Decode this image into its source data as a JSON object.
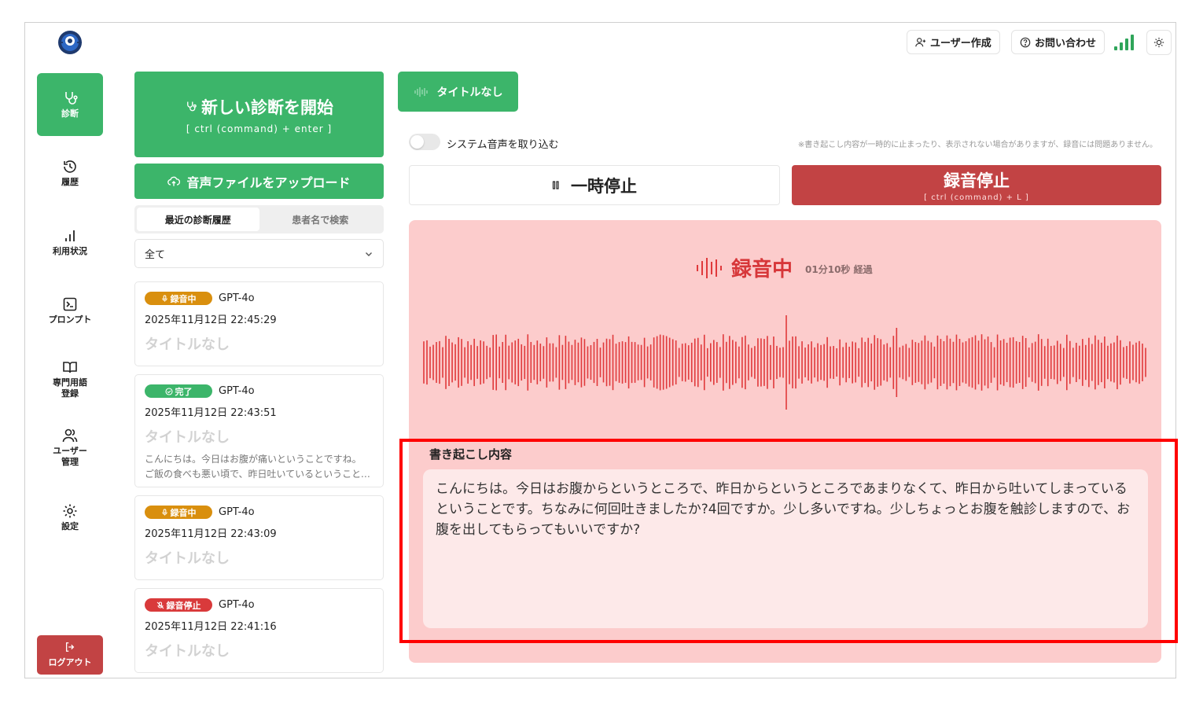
{
  "header": {
    "create_user": "ユーザー作成",
    "contact": "お問い合わせ"
  },
  "sidebar": {
    "items": [
      {
        "label": "診断",
        "icon": "stethoscope-icon"
      },
      {
        "label": "履歴",
        "icon": "history-icon"
      },
      {
        "label": "利用状況",
        "icon": "bar-chart-icon"
      },
      {
        "label": "プロンプト",
        "icon": "terminal-icon"
      },
      {
        "label": "専門用語\n登録",
        "icon": "book-icon"
      },
      {
        "label": "ユーザー\n管理",
        "icon": "users-icon"
      },
      {
        "label": "設定",
        "icon": "gear-icon"
      }
    ],
    "logout": "ログアウト"
  },
  "left": {
    "new_diagnosis": "新しい診断を開始",
    "new_diagnosis_shortcut": "[ ctrl (command) + enter ]",
    "upload": "音声ファイルをアップロード",
    "tabs": [
      "最近の診断履歴",
      "患者名で検索"
    ],
    "filter": "全て",
    "cards": [
      {
        "status": "録音中",
        "model": "GPT-4o",
        "date": "2025年11月12日 22:45:29",
        "title": "タイトルなし"
      },
      {
        "status": "完了",
        "model": "GPT-4o",
        "date": "2025年11月12日 22:43:51",
        "title": "タイトルなし",
        "preview1": "こんにちは。今日はお腹が痛いということですね。",
        "preview2": "ご飯の食べも悪い頃で、昨日吐いているということですね"
      },
      {
        "status": "録音中",
        "model": "GPT-4o",
        "date": "2025年11月12日 22:43:09",
        "title": "タイトルなし"
      },
      {
        "status": "録音停止",
        "model": "GPT-4o",
        "date": "2025年11月12日 22:41:16",
        "title": "タイトルなし"
      }
    ]
  },
  "main": {
    "title_chip": "タイトルなし",
    "system_audio": "システム音声を取り込む",
    "note": "※書き起こし内容が一時的に止まったり、表示されない場合がありますが、録音には問題ありません。",
    "pause": "一時停止",
    "stop": "録音停止",
    "stop_shortcut": "[ ctrl (command) + L ]",
    "recording": "録音中",
    "elapsed": "01分10秒 経過",
    "transcript_label": "書き起こし内容",
    "transcript": "こんにちは。今日はお腹からというところで、昨日からというところであまりなくて、昨日から吐いてしまっているということです。ちなみに何回吐きましたか?4回ですか。少し多いですね。少しちょっとお腹を触診しますので、お腹を出してもらってもいいですか?"
  },
  "colors": {
    "green": "#3cb56a",
    "red": "#c24344",
    "panel": "#fccccc",
    "wave": "#e0393b",
    "highlight": "#ff0000"
  }
}
